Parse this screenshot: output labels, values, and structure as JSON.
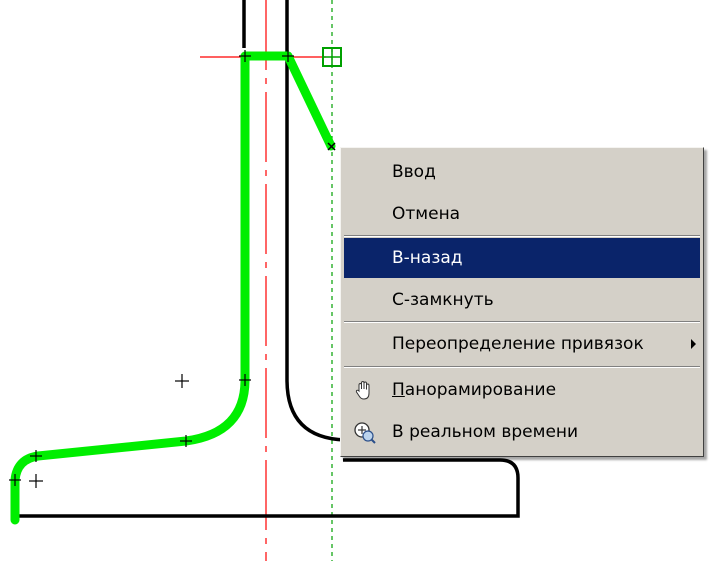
{
  "drawing": {
    "line_color": "#000000",
    "highlight_color": "#00ee00",
    "centerline_color": "#ff0000",
    "tracking_color": "#00a000"
  },
  "menu": {
    "items": [
      {
        "label": "Ввод",
        "highlighted": false
      },
      {
        "label": "Отмена",
        "highlighted": false
      },
      {
        "label": "В-назад",
        "highlighted": true
      },
      {
        "label": "С-замкнуть",
        "highlighted": false
      },
      {
        "label": "Переопределение привязок",
        "has_submenu": true,
        "highlighted": false
      },
      {
        "label_access_key": "П",
        "label_rest": "анорамирование",
        "icon": "pan-hand-icon",
        "highlighted": false
      },
      {
        "label": "В реальном времени",
        "icon": "zoom-realtime-icon",
        "highlighted": false
      }
    ],
    "colors": {
      "background": "#d4d0c8",
      "highlight_background": "#0a246a",
      "highlight_text": "#ffffff",
      "text": "#000000"
    }
  }
}
